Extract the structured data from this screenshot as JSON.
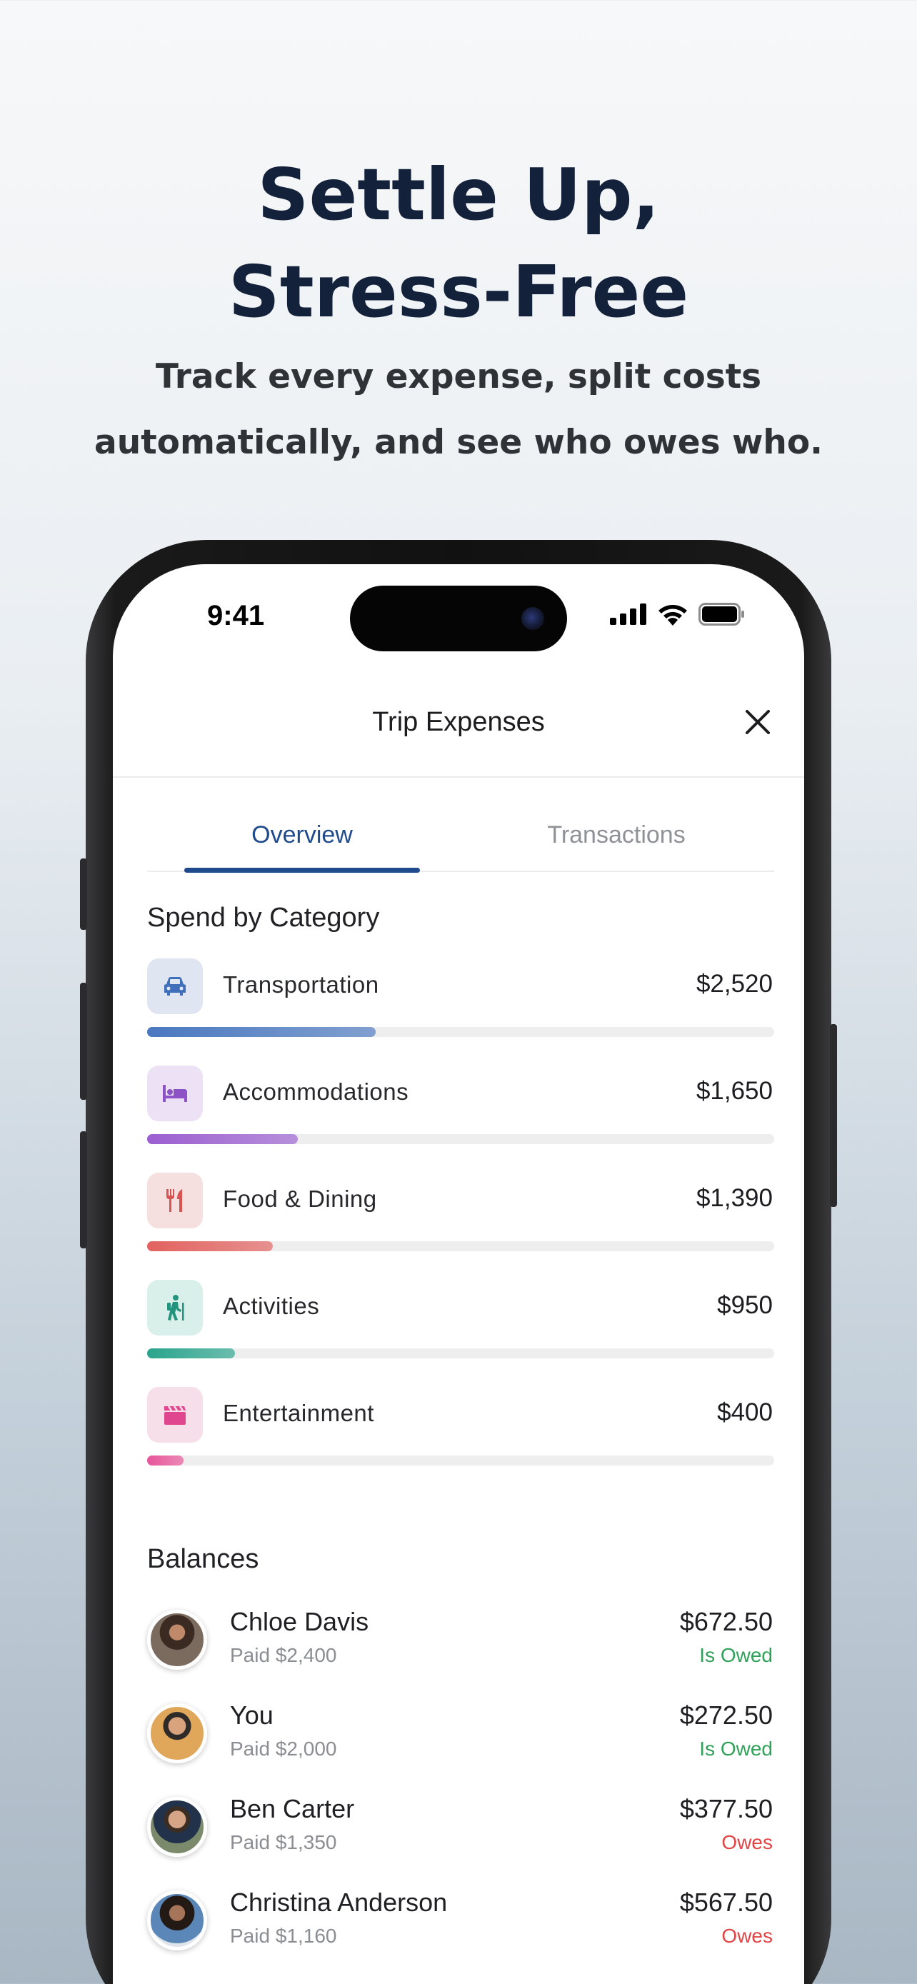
{
  "hero": {
    "title_line1": "Settle Up,",
    "title_line2": "Stress-Free",
    "subtitle_line1": "Track every expense, split costs",
    "subtitle_line2": "automatically, and see who owes who."
  },
  "status_bar": {
    "time": "9:41"
  },
  "nav": {
    "title": "Trip Expenses",
    "close_icon": "close-icon"
  },
  "tabs": [
    {
      "label": "Overview",
      "active": true
    },
    {
      "label": "Transactions",
      "active": false
    }
  ],
  "spend": {
    "title": "Spend by Category",
    "items": [
      {
        "label": "Transportation",
        "value": "$2,520",
        "icon": "car-icon",
        "fraction": 0.365,
        "color": "#4a78c0",
        "bg": "#dfe6f2"
      },
      {
        "label": "Accommodations",
        "value": "$1,650",
        "icon": "bed-icon",
        "fraction": 0.24,
        "color": "#9b5fd0",
        "bg": "#ede2f5"
      },
      {
        "label": "Food & Dining",
        "value": "$1,390",
        "icon": "utensils-icon",
        "fraction": 0.2,
        "color": "#e2625f",
        "bg": "#f6e0df"
      },
      {
        "label": "Activities",
        "value": "$950",
        "icon": "hiking-icon",
        "fraction": 0.14,
        "color": "#2aa48c",
        "bg": "#d9efea"
      },
      {
        "label": "Entertainment",
        "value": "$400",
        "icon": "clapperboard-icon",
        "fraction": 0.058,
        "color": "#e8559a",
        "bg": "#f7dfea"
      }
    ]
  },
  "balances": {
    "title": "Balances",
    "people": [
      {
        "name": "Chloe Davis",
        "paid": "Paid $2,400",
        "amount": "$672.50",
        "status": "Is Owed",
        "status_color": "#2fa158"
      },
      {
        "name": "You",
        "paid": "Paid $2,000",
        "amount": "$272.50",
        "status": "Is Owed",
        "status_color": "#2fa158"
      },
      {
        "name": "Ben Carter",
        "paid": "Paid $1,350",
        "amount": "$377.50",
        "status": "Owes",
        "status_color": "#e14545"
      },
      {
        "name": "Christina Anderson",
        "paid": "Paid $1,160",
        "amount": "$567.50",
        "status": "Owes",
        "status_color": "#e14545"
      }
    ]
  },
  "colors": {
    "accent": "#1f4a8c",
    "owed": "#2fa158",
    "owes": "#e14545"
  }
}
